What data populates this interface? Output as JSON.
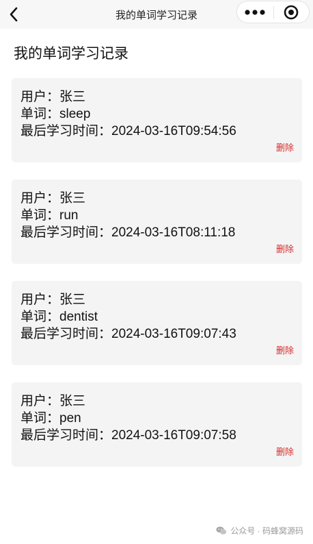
{
  "navbar": {
    "title": "我的单词学习记录"
  },
  "page": {
    "heading": "我的单词学习记录"
  },
  "labels": {
    "user_prefix": "用户：",
    "word_prefix": "单词：",
    "time_prefix": "最后学习时间："
  },
  "records": [
    {
      "user": "张三",
      "word": "sleep",
      "last_study_time": "2024-03-16T09:54:56",
      "delete_label": "删除"
    },
    {
      "user": "张三",
      "word": "run",
      "last_study_time": "2024-03-16T08:11:18",
      "delete_label": "删除"
    },
    {
      "user": "张三",
      "word": "dentist",
      "last_study_time": "2024-03-16T09:07:43",
      "delete_label": "删除"
    },
    {
      "user": "张三",
      "word": "pen",
      "last_study_time": "2024-03-16T09:07:58",
      "delete_label": "删除"
    }
  ],
  "watermark": {
    "text": "公众号 · 码蜂窝源码",
    "icon": "wechat-icon"
  },
  "icons": {
    "back": "chevron-left-icon",
    "more": "more-dots-icon",
    "close": "target-circle-icon"
  },
  "colors": {
    "delete": "#d42d2d",
    "card_background": "#f4f4f4",
    "navbar_background": "#f7f7f7"
  }
}
